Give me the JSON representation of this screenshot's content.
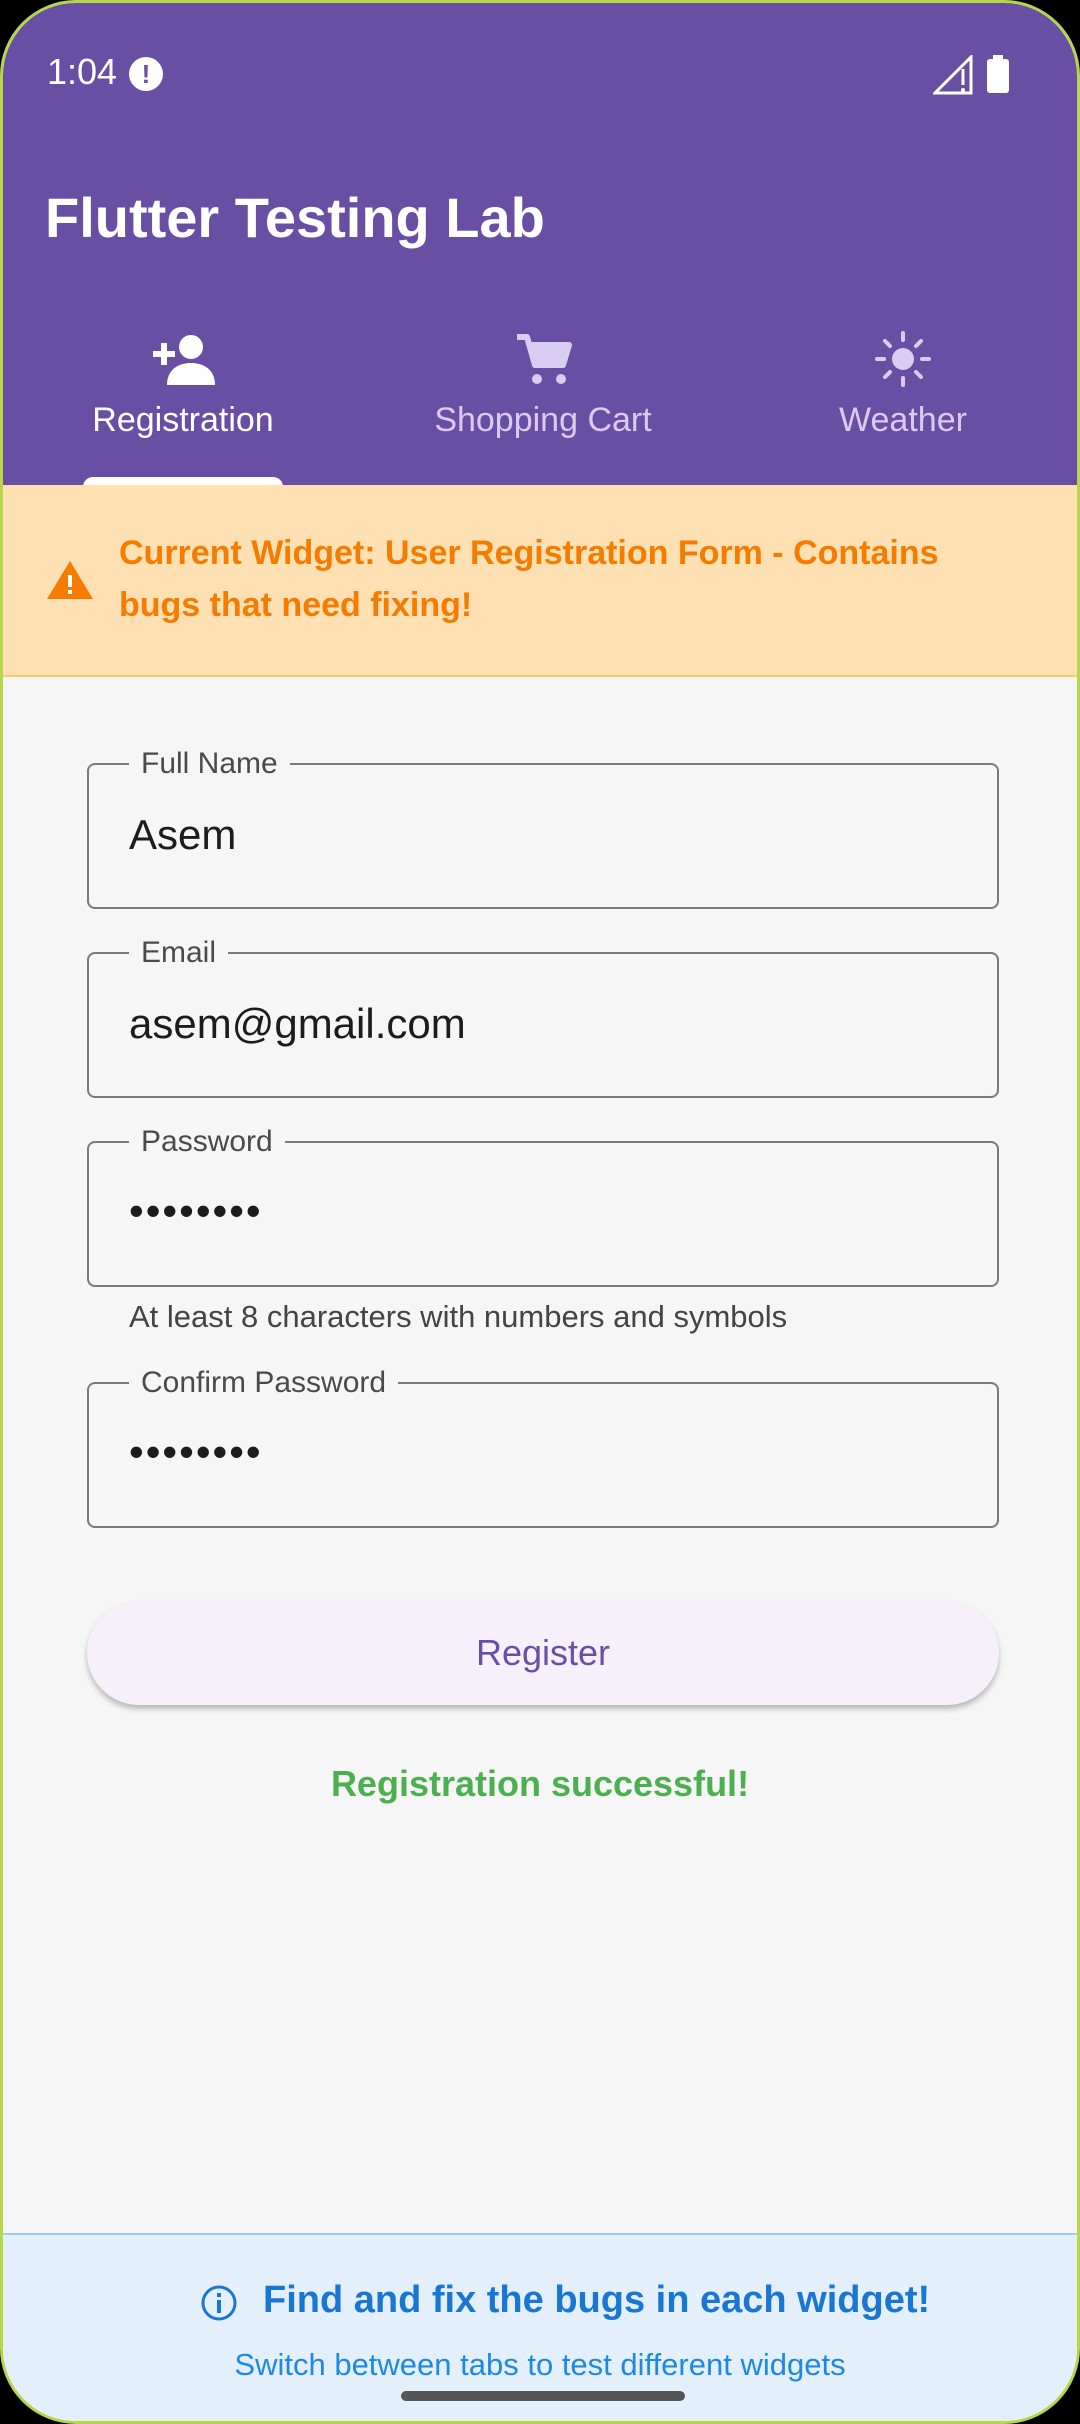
{
  "status_bar": {
    "time": "1:04",
    "alert_glyph": "!"
  },
  "app": {
    "title": "Flutter Testing Lab",
    "accent": "#684fa3"
  },
  "tabs": [
    {
      "label": "Registration",
      "icon": "person-add-icon",
      "active": true
    },
    {
      "label": "Shopping Cart",
      "icon": "shopping-cart-icon",
      "active": false
    },
    {
      "label": "Weather",
      "icon": "sun-icon",
      "active": false
    }
  ],
  "banner": {
    "text": "Current Widget: User Registration Form - Contains bugs that need fixing!",
    "icon": "warning-icon",
    "color": "#f57c00"
  },
  "form": {
    "full_name": {
      "label": "Full Name",
      "value": "Asem"
    },
    "email": {
      "label": "Email",
      "value": "asem@gmail.com"
    },
    "password": {
      "label": "Password",
      "value": "••••••••",
      "helper": "At least 8 characters with numbers and symbols"
    },
    "confirm_password": {
      "label": "Confirm Password",
      "value": "••••••••"
    },
    "register_label": "Register",
    "status_message": "Registration successful!",
    "status_color": "#4caf50"
  },
  "footer": {
    "icon": "info-icon",
    "title": "Find and fix the bugs in each widget!",
    "subtitle": "Switch between tabs to test different widgets"
  }
}
